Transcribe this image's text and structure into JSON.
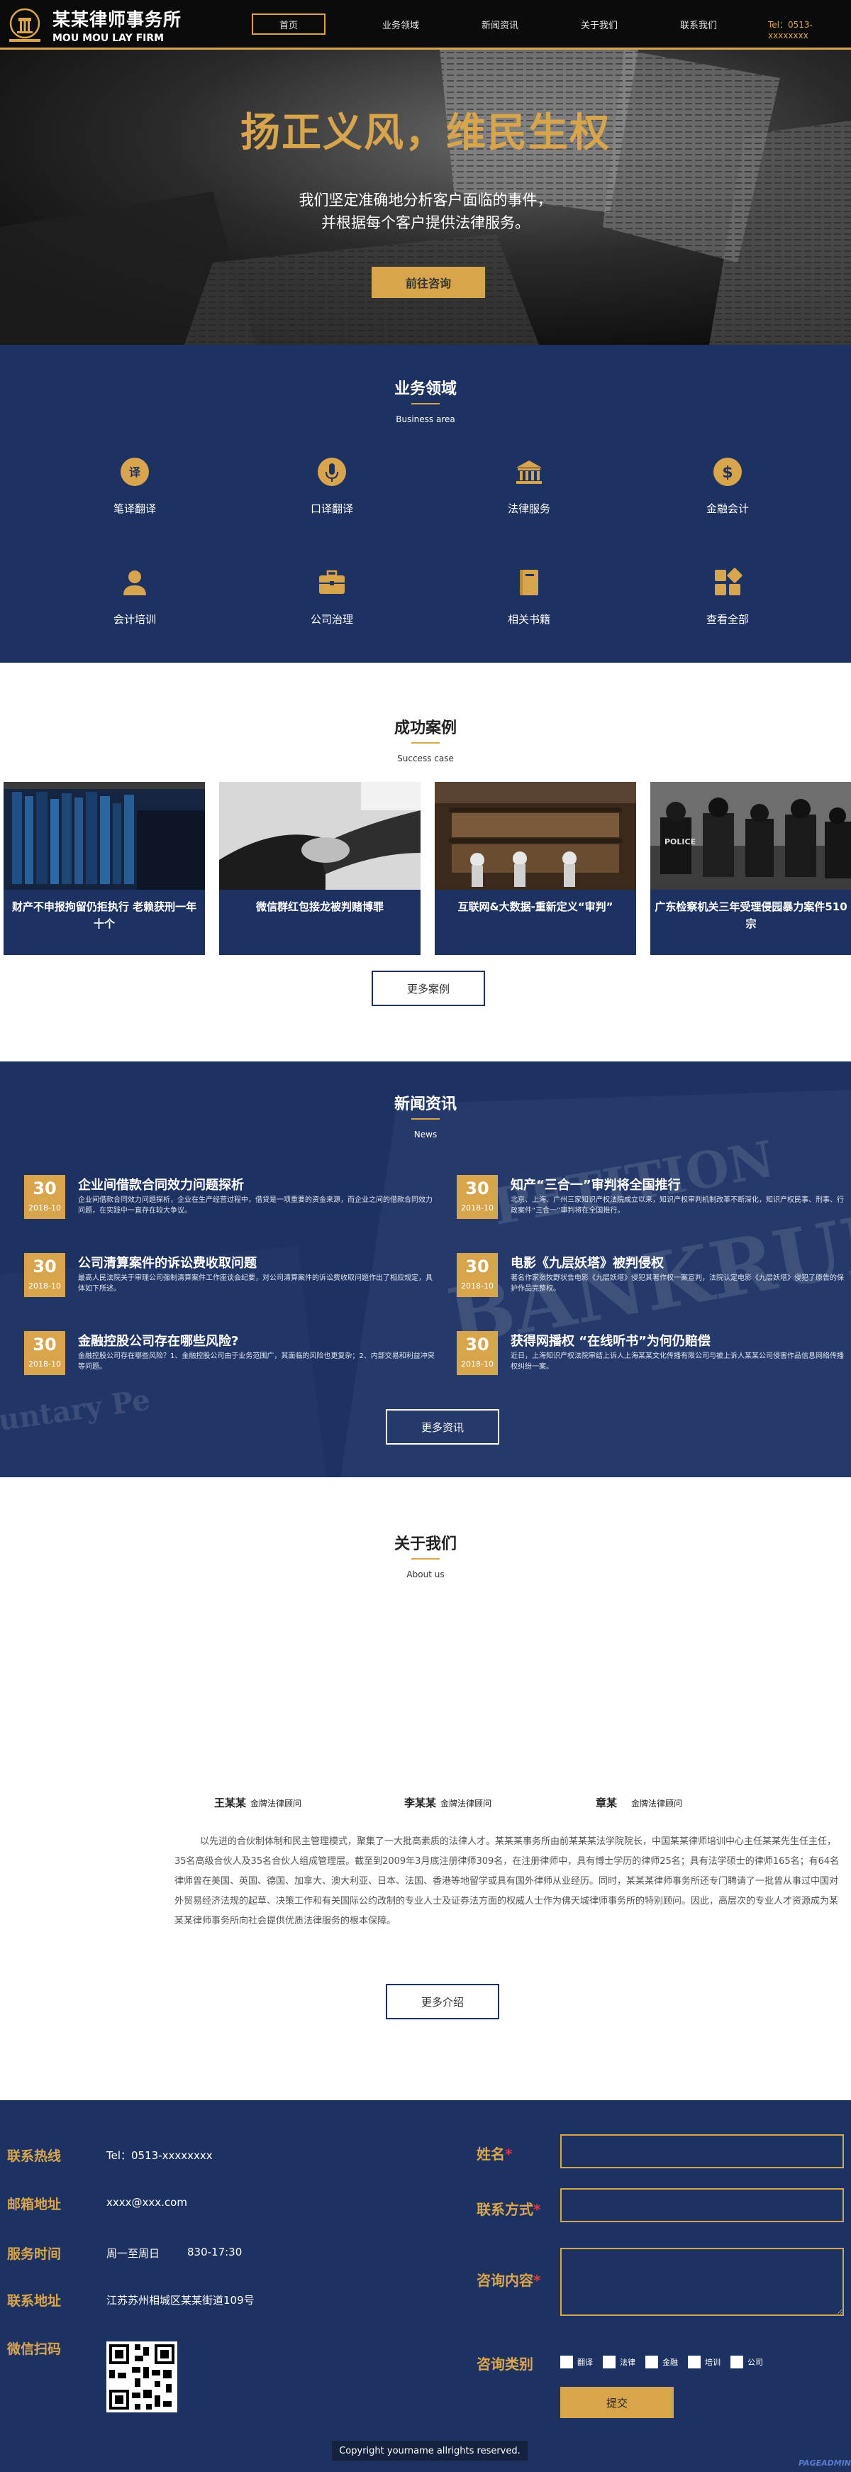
{
  "header": {
    "logo_cn": "某某律师事务所",
    "logo_en": "MOU MOU LAY FIRM",
    "nav": [
      "首页",
      "业务领域",
      "新闻资讯",
      "关于我们",
      "联系我们"
    ],
    "tel": "Tel：0513-xxxxxxxx"
  },
  "hero": {
    "title": "扬正义风，维民生权",
    "subtitle_line1": "我们坚定准确地分析客户面临的事件，",
    "subtitle_line2": "并根据每个客户提供法律服务。",
    "button": "前往咨询"
  },
  "business": {
    "title": "业务领域",
    "subtitle": "Business area",
    "items": [
      {
        "label": "笔译翻译",
        "icon": "translate-icon"
      },
      {
        "label": "口译翻译",
        "icon": "microphone-icon"
      },
      {
        "label": "法律服务",
        "icon": "courthouse-icon"
      },
      {
        "label": "金融会计",
        "icon": "dollar-icon"
      },
      {
        "label": "会计培训",
        "icon": "person-icon"
      },
      {
        "label": "公司治理",
        "icon": "briefcase-icon"
      },
      {
        "label": "相关书籍",
        "icon": "book-icon"
      },
      {
        "label": "查看全部",
        "icon": "grid-icon"
      }
    ]
  },
  "cases": {
    "title": "成功案例",
    "subtitle": "Success case",
    "items": [
      "财产不申报拘留仍拒执行 老赖获刑一年十个",
      "微信群红包接龙被判赌博罪",
      "互联网&大数据-重新定义“审判”",
      "广东检察机关三年受理侵园暴力案件510宗"
    ],
    "more": "更多案例"
  },
  "news": {
    "title": "新闻资讯",
    "subtitle": "News",
    "items": [
      {
        "day": "30",
        "ym": "2018-10",
        "title": "企业间借款合同效力问题探析",
        "desc": "企业间借款合同效力问题探析，企业在生产经营过程中，借贷是一项重要的资金来源，而企业之间的借款合同效力问题，在实践中一直存在较大争议。"
      },
      {
        "day": "30",
        "ym": "2018-10",
        "title": "知产“三合一”审判将全国推行",
        "desc": "北京、上海、广州三家知识产权法院成立以来，知识产权审判机制改革不断深化，知识产权民事、刑事、行政案件“三合一”审判将在全国推行。"
      },
      {
        "day": "30",
        "ym": "2018-10",
        "title": "公司清算案件的诉讼费收取问题",
        "desc": "最高人民法院关于审理公司强制清算案件工作座谈会纪要，对公司清算案件的诉讼费收取问题作出了相应规定，具体如下所述。"
      },
      {
        "day": "30",
        "ym": "2018-10",
        "title": "电影《九层妖塔》被判侵权",
        "desc": "著名作家张牧野状告电影《九层妖塔》侵犯其著作权一案宣判，法院认定电影《九层妖塔》侵犯了原告的保护作品完整权。"
      },
      {
        "day": "30",
        "ym": "2018-10",
        "title": "金融控股公司存在哪些风险?",
        "desc": "金融控股公司存在哪些风险？1、金融控股公司由于业务范围广，其面临的风险也更复杂；2、内部交易和利益冲突等问题。"
      },
      {
        "day": "30",
        "ym": "2018-10",
        "title": "获得网播权 “在线听书”为何仍赔偿",
        "desc": "近日，上海知识产权法院审结上诉人上海某某文化传播有限公司与被上诉人某某公司侵害作品信息网络传播权纠纷一案。"
      }
    ],
    "more": "更多资讯"
  },
  "about": {
    "title": "关于我们",
    "subtitle": "About us",
    "lawyers": [
      {
        "name": "王某某",
        "role": "金牌法律顾问"
      },
      {
        "name": "李某某",
        "role": "金牌法律顾问"
      },
      {
        "name": "章某",
        "role": "金牌法律顾问"
      }
    ],
    "text": "以先进的合伙制体制和民主管理模式，聚集了一大批高素质的法律人才。某某某事务所由前某某某法学院院长，中国某某律师培训中心主任某某先生任主任，35名高级合伙人及35名合伙人组成管理层。截至到2009年3月底注册律师309名，在注册律师中，具有博士学历的律师25名；具有法学硕士的律师165名；有64名律师曾在美国、英国、德国、加拿大、澳大利亚、日本、法国、香港等地留学或具有国外律师从业经历。同时，某某某律师事务所还专门聘请了一批曾从事过中国对外贸易经济法规的起草、决策工作和有关国际公约改制的专业人士及证券法方面的权威人士作为佛天城律师事务所的特别顾问。因此，高层次的专业人才资源成为某某某律师事务所向社会提供优质法律服务的根本保障。",
    "more": "更多介绍"
  },
  "footer": {
    "hotline_label": "联系热线",
    "hotline": "Tel：0513-xxxxxxxx",
    "email_label": "邮箱地址",
    "email": "xxxx@xxx.com",
    "hours_label": "服务时间",
    "hours_days": "周一至周日",
    "hours_time": "830-17:30",
    "address_label": "联系地址",
    "address": "江苏苏州相城区某某街道109号",
    "wechat_label": "微信扫码",
    "form": {
      "name_label": "姓名",
      "contact_label": "联系方式",
      "content_label": "咨询内容",
      "type_label": "咨询类别",
      "options": [
        "翻译",
        "法律",
        "金融",
        "培训",
        "公司"
      ],
      "submit": "提交"
    },
    "copyright": "Copyright yourname allrights reserved.",
    "watermark": "PAGEADMIN"
  }
}
